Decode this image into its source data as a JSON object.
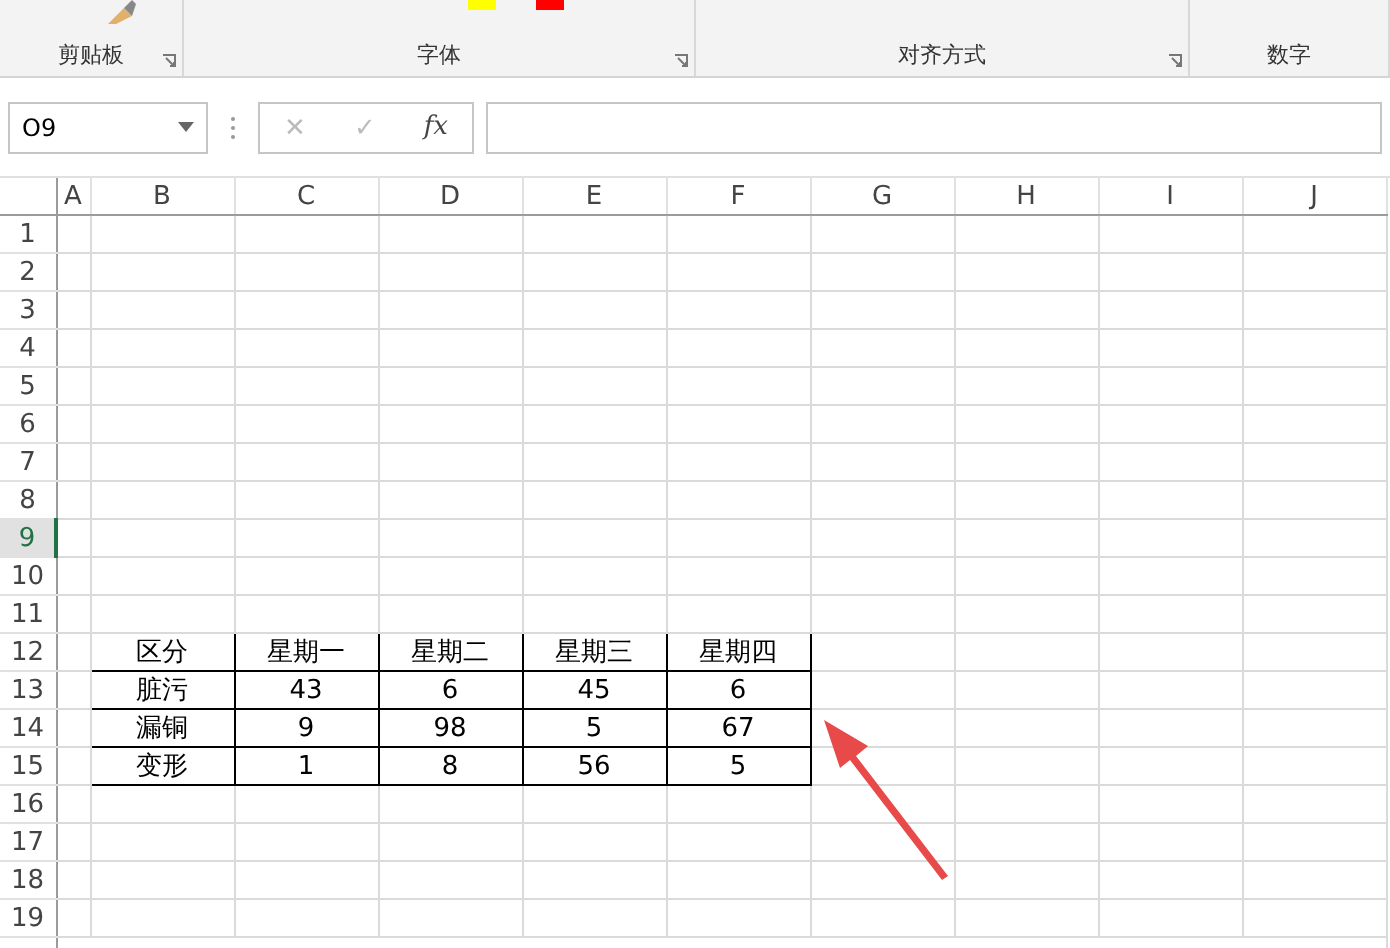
{
  "ribbon": {
    "groups": [
      {
        "label": "剪贴板",
        "launcher": true
      },
      {
        "label": "字体",
        "launcher": true
      },
      {
        "label": "对齐方式",
        "launcher": true
      },
      {
        "label": "数字",
        "launcher": false
      }
    ]
  },
  "formula_bar": {
    "name_box": "O9",
    "cancel": "✕",
    "enter": "✓",
    "function": "fx"
  },
  "columns": [
    "A",
    "B",
    "C",
    "D",
    "E",
    "F",
    "G",
    "H",
    "I",
    "J"
  ],
  "rows": [
    {
      "label": "1",
      "selected": false
    },
    {
      "label": "2",
      "selected": false
    },
    {
      "label": "3",
      "selected": false
    },
    {
      "label": "4",
      "selected": false
    },
    {
      "label": "5",
      "selected": false
    },
    {
      "label": "6",
      "selected": false
    },
    {
      "label": "7",
      "selected": false
    },
    {
      "label": "8",
      "selected": false
    },
    {
      "label": "9",
      "selected": true
    },
    {
      "label": "10",
      "selected": false
    },
    {
      "label": "11",
      "selected": false
    },
    {
      "label": "12",
      "selected": false,
      "cells": [
        "区分",
        "星期一",
        "星期二",
        "星期三",
        "星期四"
      ]
    },
    {
      "label": "13",
      "selected": false,
      "cells": [
        "脏污",
        "43",
        "6",
        "45",
        "6"
      ]
    },
    {
      "label": "14",
      "selected": false,
      "cells": [
        "漏铜",
        "9",
        "98",
        "5",
        "67"
      ]
    },
    {
      "label": "15",
      "selected": false,
      "cells": [
        "变形",
        "1",
        "8",
        "56",
        "5"
      ]
    },
    {
      "label": "16",
      "selected": false
    },
    {
      "label": "17",
      "selected": false
    },
    {
      "label": "18",
      "selected": false
    },
    {
      "label": "19",
      "selected": false
    }
  ]
}
